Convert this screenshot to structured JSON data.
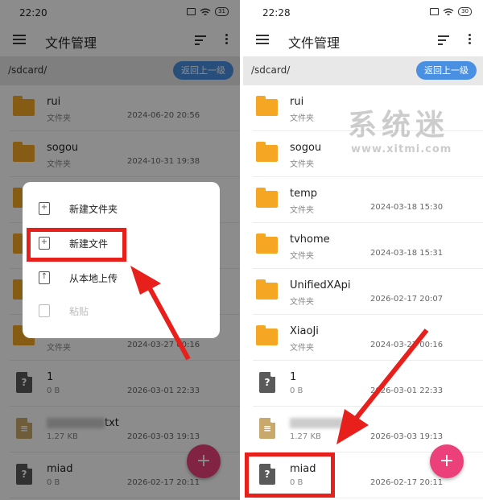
{
  "left": {
    "status_time": "22:20",
    "battery": "31",
    "title": "文件管理",
    "path": "/sdcard/",
    "back_label": "返回上一级",
    "items": [
      {
        "type": "folder",
        "name": "rui",
        "meta": "文件夹",
        "date": "2024-06-20 20:56"
      },
      {
        "type": "folder",
        "name": "sogou",
        "meta": "文件夹",
        "date": "2024-10-31 19:38"
      },
      {
        "type": "folder",
        "name": "",
        "meta": "",
        "date": ""
      },
      {
        "type": "folder",
        "name": "",
        "meta": "",
        "date": ""
      },
      {
        "type": "folder",
        "name": "",
        "meta": "",
        "date": ""
      },
      {
        "type": "folder",
        "name": "",
        "meta": "文件夹",
        "date": "2024-03-27 00:16"
      },
      {
        "type": "file",
        "name": "1",
        "meta": "0 B",
        "date": "2026-03-01 22:33"
      },
      {
        "type": "txt",
        "name": "txt",
        "meta": "1.27 KB",
        "date": "2026-03-03 19:13"
      },
      {
        "type": "file",
        "name": "miad",
        "meta": "0 B",
        "date": "2026-02-17 20:11"
      }
    ],
    "menu": [
      {
        "label": "新建文件夹",
        "icon": "new-folder-icon"
      },
      {
        "label": "新建文件",
        "icon": "new-file-icon"
      },
      {
        "label": "从本地上传",
        "icon": "upload-icon"
      },
      {
        "label": "粘贴",
        "icon": "paste-icon"
      }
    ],
    "fab": "+"
  },
  "right": {
    "status_time": "22:28",
    "battery": "30",
    "title": "文件管理",
    "path": "/sdcard/",
    "back_label": "返回上一级",
    "items": [
      {
        "type": "folder",
        "name": "rui",
        "meta": "文件夹",
        "date": ""
      },
      {
        "type": "folder",
        "name": "sogou",
        "meta": "文件夹",
        "date": ""
      },
      {
        "type": "folder",
        "name": "temp",
        "meta": "文件夹",
        "date": "2024-03-18 15:30"
      },
      {
        "type": "folder",
        "name": "tvhome",
        "meta": "文件夹",
        "date": "2024-03-18 15:31"
      },
      {
        "type": "folder",
        "name": "UnifiedXApi",
        "meta": "文件夹",
        "date": "2026-02-17 20:07"
      },
      {
        "type": "folder",
        "name": "XiaoJi",
        "meta": "文件夹",
        "date": "2024-03-27 00:16"
      },
      {
        "type": "file",
        "name": "1",
        "meta": "0 B",
        "date": "2026-03-01 22:33"
      },
      {
        "type": "txt",
        "name": "",
        "meta": "1.27 KB",
        "date": "2026-03-03 19:13"
      },
      {
        "type": "file",
        "name": "miad",
        "meta": "0 B",
        "date": "2026-02-17 20:11"
      }
    ],
    "fab": "+"
  },
  "watermark": {
    "line1": "系统迷",
    "line2": "www.xitmi.com"
  },
  "colors": {
    "accent": "#4a90e2",
    "folder": "#f5a623",
    "fab": "#ec407a",
    "highlight": "#e8201c"
  }
}
